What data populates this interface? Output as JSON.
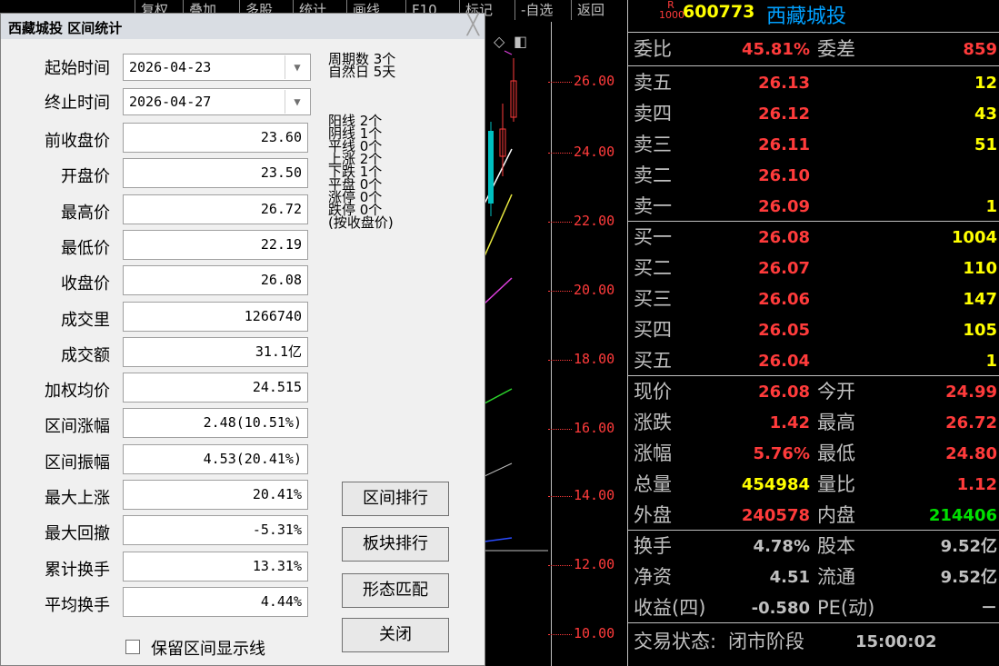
{
  "toolbar": [
    "复权",
    "叠加",
    "多股",
    "统计",
    "画线",
    "F10",
    "标记",
    "-自选",
    "返回"
  ],
  "chart": {
    "y_labels": [
      "26.00",
      "24.00",
      "22.00",
      "20.00",
      "18.00",
      "16.00",
      "14.00",
      "12.00",
      "10.00"
    ]
  },
  "panel": {
    "badge_top": "R",
    "badge_bottom": "1000",
    "code": "600773",
    "name": "西藏城投",
    "weibi_label": "委比",
    "weibi": "45.81%",
    "weicha_label": "委差",
    "weicha": "859",
    "asks": [
      {
        "label": "卖五",
        "price": "26.13",
        "vol": "12"
      },
      {
        "label": "卖四",
        "price": "26.12",
        "vol": "43"
      },
      {
        "label": "卖三",
        "price": "26.11",
        "vol": "51"
      },
      {
        "label": "卖二",
        "price": "26.10",
        "vol": ""
      },
      {
        "label": "卖一",
        "price": "26.09",
        "vol": "1"
      }
    ],
    "bids": [
      {
        "label": "买一",
        "price": "26.08",
        "vol": "1004"
      },
      {
        "label": "买二",
        "price": "26.07",
        "vol": "110"
      },
      {
        "label": "买三",
        "price": "26.06",
        "vol": "147"
      },
      {
        "label": "买四",
        "price": "26.05",
        "vol": "105"
      },
      {
        "label": "买五",
        "price": "26.04",
        "vol": "1"
      }
    ],
    "quote": [
      {
        "l1": "现价",
        "v1": "26.08",
        "l2": "今开",
        "v2": "24.99"
      },
      {
        "l1": "涨跌",
        "v1": "1.42",
        "l2": "最高",
        "v2": "26.72"
      },
      {
        "l1": "涨幅",
        "v1": "5.76%",
        "l2": "最低",
        "v2": "24.80"
      },
      {
        "l1": "总量",
        "v1": "454984",
        "l2": "量比",
        "v2": "1.12"
      },
      {
        "l1": "外盘",
        "v1": "240578",
        "l2": "内盘",
        "v2": "214406"
      }
    ],
    "fund": [
      {
        "l1": "换手",
        "v1": "4.78%",
        "l2": "股本",
        "v2": "9.52亿"
      },
      {
        "l1": "净资",
        "v1": "4.51",
        "l2": "流通",
        "v2": "9.52亿"
      },
      {
        "l1": "收益(四)",
        "v1": "-0.580",
        "l2": "PE(动)",
        "v2": "－"
      }
    ],
    "status_label": "交易状态:",
    "status": "闭市阶段",
    "status_time": "15:00:02"
  },
  "dialog": {
    "title": "西藏城投 区间统计",
    "close": "╳",
    "start_label": "起始时间",
    "start": "2026-04-23",
    "end_label": "终止时间",
    "end": "2026-04-27",
    "fields": [
      {
        "label": "前收盘价",
        "value": "23.60"
      },
      {
        "label": "开盘价",
        "value": "23.50"
      },
      {
        "label": "最高价",
        "value": "26.72"
      },
      {
        "label": "最低价",
        "value": "22.19"
      },
      {
        "label": "收盘价",
        "value": "26.08"
      },
      {
        "label": "成交里",
        "value": "1266740"
      },
      {
        "label": "成交额",
        "value": "31.1亿"
      },
      {
        "label": "加权均价",
        "value": "24.515"
      },
      {
        "label": "区间涨幅",
        "value": "2.48(10.51%)"
      },
      {
        "label": "区间振幅",
        "value": "4.53(20.41%)"
      },
      {
        "label": "最大上涨",
        "value": "20.41%"
      },
      {
        "label": "最大回撤",
        "value": "-5.31%"
      },
      {
        "label": "累计换手",
        "value": "13.31%"
      },
      {
        "label": "平均换手",
        "value": "4.44%"
      }
    ],
    "stats": [
      "周期数 3个",
      "自然日 5天",
      "阳线 2个",
      "阴线 1个",
      "平线 0个",
      "上涨 2个",
      "下跌 1个",
      "平盘 0个",
      "涨停 0个",
      "跌停 0个",
      "(按收盘价)"
    ],
    "buttons": {
      "rank": "区间排行",
      "sector": "板块排行",
      "pattern": "形态匹配",
      "close": "关闭"
    },
    "checkbox_label": "保留区间显示线"
  }
}
